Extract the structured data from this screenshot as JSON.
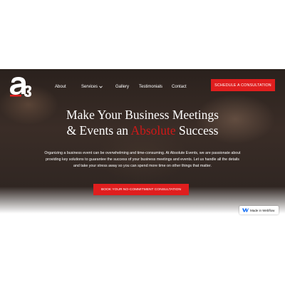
{
  "nav": {
    "items": [
      {
        "label": "About"
      },
      {
        "label": "Services"
      },
      {
        "label": "Gallery"
      },
      {
        "label": "Testimonials"
      },
      {
        "label": "Contact"
      }
    ],
    "cta_label": "SCHEDULE A CONSULTATION"
  },
  "hero": {
    "headline_line1": "Make Your Business Meetings",
    "headline_line2_pre": "& Events an ",
    "headline_accent": "Absolute",
    "headline_line2_post": " Success",
    "body": "Organizing a business event can be overwhelming and time-consuming. At Absolute Events, we are passionate about providing key solutions to guarantee the success of your business meetings and events. Let us handle all the details and take your stress away so you can spend more time on other things that matter.",
    "cta_label": "BOOK YOUR NO-COMMITMENT CONSULTATION"
  },
  "badge": {
    "label": "Made in Webflow",
    "icon": "webflow-icon"
  },
  "logo": {
    "icon": "absolute-events-logo-icon"
  },
  "colors": {
    "accent": "#e01e1e",
    "headline_accent": "#d01818"
  }
}
